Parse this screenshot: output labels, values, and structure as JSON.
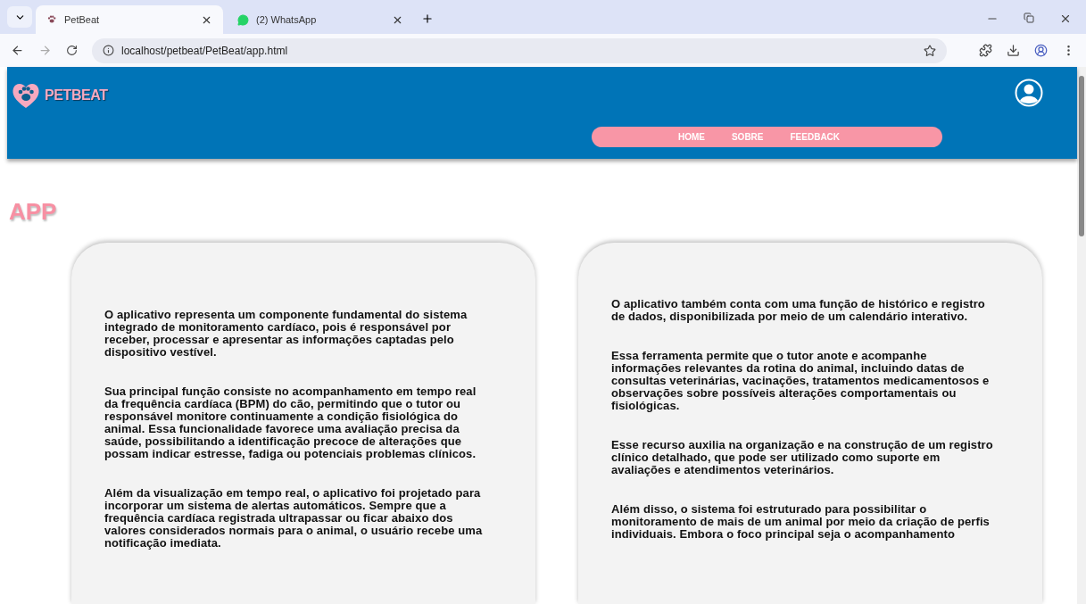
{
  "browser": {
    "tabs": [
      {
        "title": "PetBeat",
        "kind": "paw",
        "selected": true
      },
      {
        "title": "(2) WhatsApp",
        "kind": "chat",
        "selected": false
      }
    ],
    "url": "localhost/petbeat/PetBeat/app.html"
  },
  "header": {
    "logo": "PETBEAT",
    "nav": [
      "HOME",
      "SOBRE",
      "FEEDBACK"
    ]
  },
  "page_title": "APP",
  "cards": [
    {
      "paragraphs": [
        "O aplicativo representa um componente fundamental do sistema integrado de monitoramento cardíaco, pois é responsável por receber, processar e apresentar as informações captadas pelo dispositivo vestível.",
        "Sua principal função consiste no acompanhamento em tempo real da frequência cardíaca (BPM) do cão, permitindo que o tutor ou responsável monitore continuamente a condição fisiológica do animal. Essa funcionalidade favorece uma avaliação precisa da saúde, possibilitando a identificação precoce de alterações que possam indicar estresse, fadiga ou potenciais problemas clínicos.",
        "Além da visualização em tempo real, o aplicativo foi projetado para incorporar um sistema de alertas automáticos. Sempre que a frequência cardíaca registrada ultrapassar ou ficar abaixo dos valores considerados normais para o animal, o usuário recebe uma notificação imediata."
      ]
    },
    {
      "paragraphs": [
        "O aplicativo também conta com uma função de histórico e registro de dados, disponibilizada por meio de um calendário interativo.",
        "Essa ferramenta permite que o tutor anote e acompanhe informações relevantes da rotina do animal, incluindo datas de consultas veterinárias, vacinações, tratamentos medicamentosos e observações sobre possíveis alterações comportamentais ou fisiológicas.",
        "Esse recurso auxilia na organização e na construção de um registro clínico detalhado, que pode ser utilizado como suporte em avaliações e atendimentos veterinários.",
        "Além disso, o sistema foi estruturado para possibilitar o monitoramento de mais de um animal por meio da criação de perfis individuais. Embora o foco principal seja o acompanhamento"
      ]
    }
  ]
}
